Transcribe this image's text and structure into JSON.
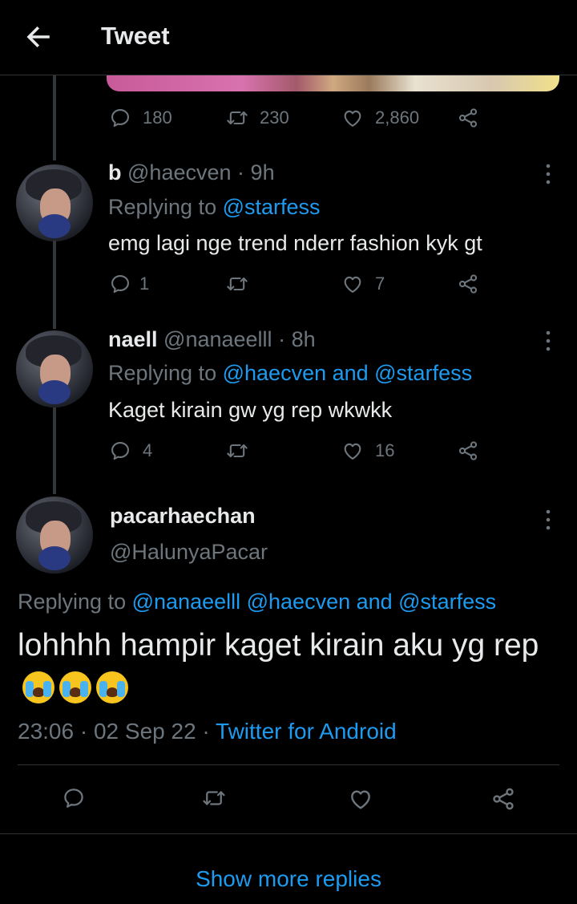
{
  "header": {
    "title": "Tweet"
  },
  "top_tweet": {
    "replies": "180",
    "retweets": "230",
    "likes": "2,860"
  },
  "replies": [
    {
      "display_name": "b",
      "handle": "@haecven",
      "time": "9h",
      "replying_prefix": "Replying to",
      "replying_to": "@starfess",
      "text": "emg lagi nge trend nderr fashion kyk gt",
      "reply_count": "1",
      "retweet_count": "",
      "like_count": "7"
    },
    {
      "display_name": "naell",
      "handle": "@nanaeelll",
      "time": "8h",
      "replying_prefix": "Replying to",
      "replying_to": "@haecven and @starfess",
      "text": "Kaget kirain gw yg rep wkwkk",
      "reply_count": "4",
      "retweet_count": "",
      "like_count": "16"
    }
  ],
  "main_tweet": {
    "display_name": "pacarhaechan",
    "handle": "@HalunyaPacar",
    "replying_prefix": "Replying to",
    "replying_to": "@nanaeelll @haecven and @starfess",
    "text": "lohhhh hampir kaget kirain aku yg rep",
    "emoji": "loudly-crying-face x3",
    "time": "23:06",
    "date": "02 Sep 22",
    "source": "Twitter for Android"
  },
  "show_more_label": "Show more replies",
  "colors": {
    "background": "#000000",
    "text": "#e7e9ea",
    "muted": "#6e767d",
    "accent": "#1d9bf0"
  },
  "icons": [
    "back-arrow-icon",
    "reply-icon",
    "retweet-icon",
    "like-icon",
    "share-icon",
    "more-icon"
  ]
}
